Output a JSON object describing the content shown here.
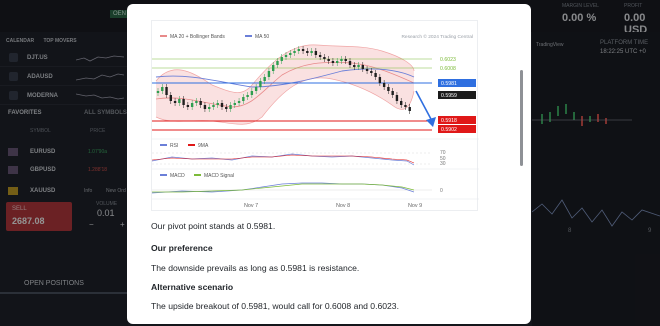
{
  "background": {
    "top_badge": "OEN",
    "top_stats": [
      {
        "label": "MARGIN LEVEL",
        "value": "0.00 %"
      },
      {
        "label": "PROFIT",
        "value": "0.00 USD"
      }
    ],
    "watchlist_tabs": [
      "CALENDAR",
      "TOP MOVERS"
    ],
    "watchlist": [
      "DJT.US",
      "ADAUSD",
      "MODERNA"
    ],
    "favorites_tab": "FAVORITES",
    "all_symbols_tab": "ALL SYMBOLS",
    "col_symbol": "SYMBOL",
    "col_price": "PRICE",
    "pairs": [
      {
        "name": "EURUSD",
        "price": "1.07'90a"
      },
      {
        "name": "GBPUSD",
        "price": "1.288'18"
      },
      {
        "name": "XAUUSD",
        "price": "",
        "extra": "Info",
        "extra2": "New Ord"
      }
    ],
    "sell_label": "SELL",
    "sell_price": "2687.08",
    "volume_label": "VOLUME",
    "lot_value": "0.01",
    "minus": "−",
    "plus": "+",
    "open_positions_tab": "OPEN POSITIONS",
    "tradingview": "TradingView",
    "platform_time_label": "PLATFORM TIME",
    "platform_time": "18:22:25 UTC +0",
    "right_axis": [
      "8",
      "9"
    ]
  },
  "modal": {
    "chart": {
      "legend_top": [
        {
          "name": "MA 20 + Bollinger Bands",
          "color": "#e88a8a"
        },
        {
          "name": "MA 50",
          "color": "#6b7fd8"
        }
      ],
      "watermark": "Research © 2024 Trading Central",
      "levels": [
        {
          "label": "0.6023",
          "color": "#7dbb3a",
          "kind": "text"
        },
        {
          "label": "0.6008",
          "color": "#7dbb3a",
          "kind": "text"
        },
        {
          "label": "0.5981",
          "color": "#2f6fe0",
          "kind": "tag"
        },
        {
          "label": "0.5959",
          "color": "#1b1b1b",
          "kind": "tag"
        },
        {
          "label": "0.5918",
          "color": "#e01818",
          "kind": "tag"
        },
        {
          "label": "0.5902",
          "color": "#e01818",
          "kind": "tag"
        }
      ],
      "rsi_legend": [
        {
          "name": "RSI",
          "color": "#6b7fd8"
        },
        {
          "name": "9MA",
          "color": "#e01818"
        }
      ],
      "rsi_ticks": [
        "70",
        "50",
        "30"
      ],
      "macd_legend": [
        {
          "name": "MACD",
          "color": "#6b7fd8"
        },
        {
          "name": "MACD Signal",
          "color": "#7dbb3a"
        }
      ],
      "macd_tick": "0",
      "x_labels": [
        "Nov 7",
        "Nov 8",
        "Nov 9"
      ]
    },
    "pivot_text": "Our pivot point stands at 0.5981.",
    "preference_heading": "Our preference",
    "preference_text": "The downside prevails as long as 0.5981 is resistance.",
    "alt_heading": "Alternative scenario",
    "alt_text": "The upside breakout of 0.5981, would call for 0.6008 and 0.6023."
  }
}
